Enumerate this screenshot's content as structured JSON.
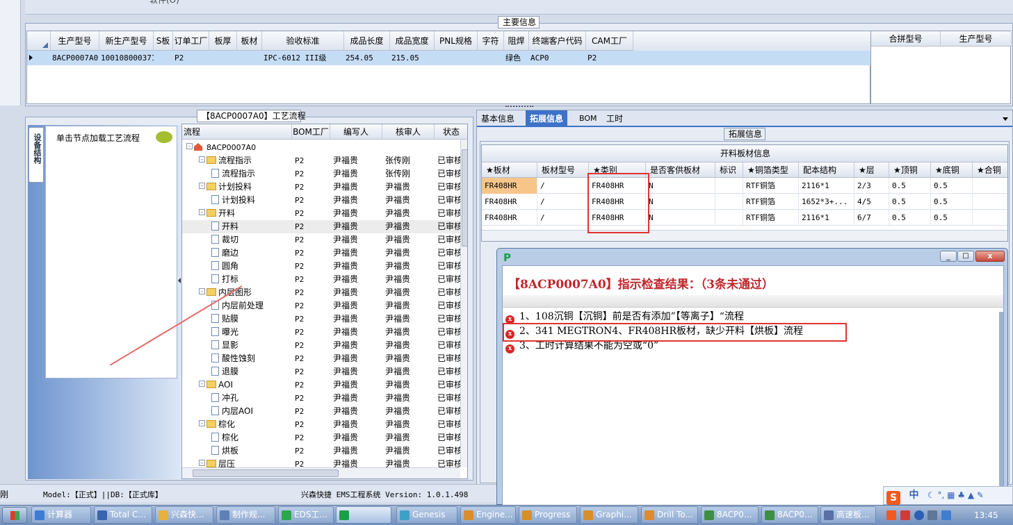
{
  "top_fragment": "软件(O)",
  "main_info": {
    "title": "主要信息",
    "columns": [
      "生产型号",
      "新生产型号",
      "S板",
      "订单工厂",
      "板厚",
      "板材",
      "验收标准",
      "成品长度",
      "成品宽度",
      "PNL规格",
      "字符",
      "阻焊",
      "终端客户代码",
      "CAM工厂"
    ],
    "row": [
      "8ACP0007A0",
      "10010800037133",
      "",
      "P2",
      "",
      "",
      "IPC-6012 III级",
      "254.05",
      "215.05",
      "",
      "",
      "绿色",
      "ACP0",
      "P2"
    ],
    "side_columns": [
      "合拼型号",
      "生产型号"
    ]
  },
  "process": {
    "title": "【8ACP0007A0】工艺流程",
    "side_tab": "设备结构",
    "load_label": "单击节点加载工艺流程",
    "columns": [
      "流程",
      "BOM工厂",
      "编写人",
      "核审人",
      "状态"
    ],
    "rows": [
      {
        "name": "8ACP0007A0",
        "bom": "",
        "writer": "",
        "reviewer": "",
        "status": ""
      },
      {
        "name": "流程指示",
        "bom": "P2",
        "writer": "尹福贵",
        "reviewer": "张传刚",
        "status": "已审核"
      },
      {
        "name": "流程指示",
        "bom": "P2",
        "writer": "尹福贵",
        "reviewer": "张传刚",
        "status": "已审核"
      },
      {
        "name": "计划投料",
        "bom": "P2",
        "writer": "尹福贵",
        "reviewer": "尹福贵",
        "status": "已审核"
      },
      {
        "name": "计划投料",
        "bom": "P2",
        "writer": "尹福贵",
        "reviewer": "尹福贵",
        "status": "已审核"
      },
      {
        "name": "开料",
        "bom": "P2",
        "writer": "尹福贵",
        "reviewer": "尹福贵",
        "status": "已审核"
      },
      {
        "name": "开料",
        "bom": "P2",
        "writer": "尹福贵",
        "reviewer": "尹福贵",
        "status": "已审核"
      },
      {
        "name": "裁切",
        "bom": "P2",
        "writer": "尹福贵",
        "reviewer": "尹福贵",
        "status": "已审核"
      },
      {
        "name": "磨边",
        "bom": "P2",
        "writer": "尹福贵",
        "reviewer": "尹福贵",
        "status": "已审核"
      },
      {
        "name": "圆角",
        "bom": "P2",
        "writer": "尹福贵",
        "reviewer": "尹福贵",
        "status": "已审核"
      },
      {
        "name": "打标",
        "bom": "P2",
        "writer": "尹福贵",
        "reviewer": "尹福贵",
        "status": "已审核"
      },
      {
        "name": "内层图形",
        "bom": "P2",
        "writer": "尹福贵",
        "reviewer": "尹福贵",
        "status": "已审核"
      },
      {
        "name": "内层前处理",
        "bom": "P2",
        "writer": "尹福贵",
        "reviewer": "尹福贵",
        "status": "已审核"
      },
      {
        "name": "贴膜",
        "bom": "P2",
        "writer": "尹福贵",
        "reviewer": "尹福贵",
        "status": "已审核"
      },
      {
        "name": "曝光",
        "bom": "P2",
        "writer": "尹福贵",
        "reviewer": "尹福贵",
        "status": "已审核"
      },
      {
        "name": "显影",
        "bom": "P2",
        "writer": "尹福贵",
        "reviewer": "尹福贵",
        "status": "已审核"
      },
      {
        "name": "酸性蚀刻",
        "bom": "P2",
        "writer": "尹福贵",
        "reviewer": "尹福贵",
        "status": "已审核"
      },
      {
        "name": "退膜",
        "bom": "P2",
        "writer": "尹福贵",
        "reviewer": "尹福贵",
        "status": "已审核"
      },
      {
        "name": "AOI",
        "bom": "P2",
        "writer": "尹福贵",
        "reviewer": "尹福贵",
        "status": "已审核"
      },
      {
        "name": "冲孔",
        "bom": "P2",
        "writer": "尹福贵",
        "reviewer": "尹福贵",
        "status": "已审核"
      },
      {
        "name": "内层AOI",
        "bom": "P2",
        "writer": "尹福贵",
        "reviewer": "尹福贵",
        "status": "已审核"
      },
      {
        "name": "棕化",
        "bom": "P2",
        "writer": "尹福贵",
        "reviewer": "尹福贵",
        "status": "已审核"
      },
      {
        "name": "棕化",
        "bom": "P2",
        "writer": "尹福贵",
        "reviewer": "尹福贵",
        "status": "已审核"
      },
      {
        "name": "烘板",
        "bom": "P2",
        "writer": "尹福贵",
        "reviewer": "尹福贵",
        "status": "已审核"
      },
      {
        "name": "层压",
        "bom": "P2",
        "writer": "尹福贵",
        "reviewer": "尹福贵",
        "status": "已审核"
      }
    ]
  },
  "tabs": [
    "基本信息",
    "拓展信息",
    "BOM",
    "工时"
  ],
  "ext_info": {
    "title": "拓展信息",
    "table_title": "开料板材信息",
    "columns": [
      "★板材",
      "板材型号",
      "★类别",
      "是否客供板材",
      "标识",
      "★铜箔类型",
      "配本结构",
      "★层",
      "★顶铜",
      "★底铜",
      "★合铜"
    ],
    "rows": [
      [
        "FR408HR",
        "/",
        "FR408HR",
        "N",
        "",
        "RTF铜箔",
        "2116*1",
        "2/3",
        "0.5",
        "0.5",
        ""
      ],
      [
        "FR408HR",
        "/",
        "FR408HR",
        "N",
        "",
        "RTF铜箔",
        "1652*3+...",
        "4/5",
        "0.5",
        "0.5",
        ""
      ],
      [
        "FR408HR",
        "/",
        "FR408HR",
        "N",
        "",
        "RTF铜箔",
        "2116*1",
        "6/7",
        "0.5",
        "0.5",
        ""
      ]
    ]
  },
  "dialog": {
    "heading": "【8ACP0007A0】指示检查结果：（3条未通过）",
    "items": [
      "1、108沉铜【沉铜】前是否有添加”【等离子】“流程",
      "2、341  MEGTRON4、FR408HR板材，缺少开料【烘板】流程",
      "3、工时计算结果不能为空或“0”"
    ]
  },
  "status": {
    "fragment": "刚",
    "model": "Model:【正式】||DB:【正式库】",
    "product": "兴森快捷  EMS工程系统  Version: 1.0.1.498"
  },
  "taskbar": {
    "items": [
      "计算器",
      "Total C...",
      "兴森快...",
      "制作规...",
      "EDS工...",
      "",
      "Genesis",
      "Engine...",
      "Progress",
      "Graphi...",
      "Drill To...",
      "8ACP0...",
      "8ACP0...",
      "高速板..."
    ],
    "clock": "13:45",
    "ime": "中"
  },
  "colors": {
    "accent": "#3c72c8",
    "error": "#d62626",
    "highlight": "#e0322f",
    "row_select": "#c5dcf5"
  }
}
